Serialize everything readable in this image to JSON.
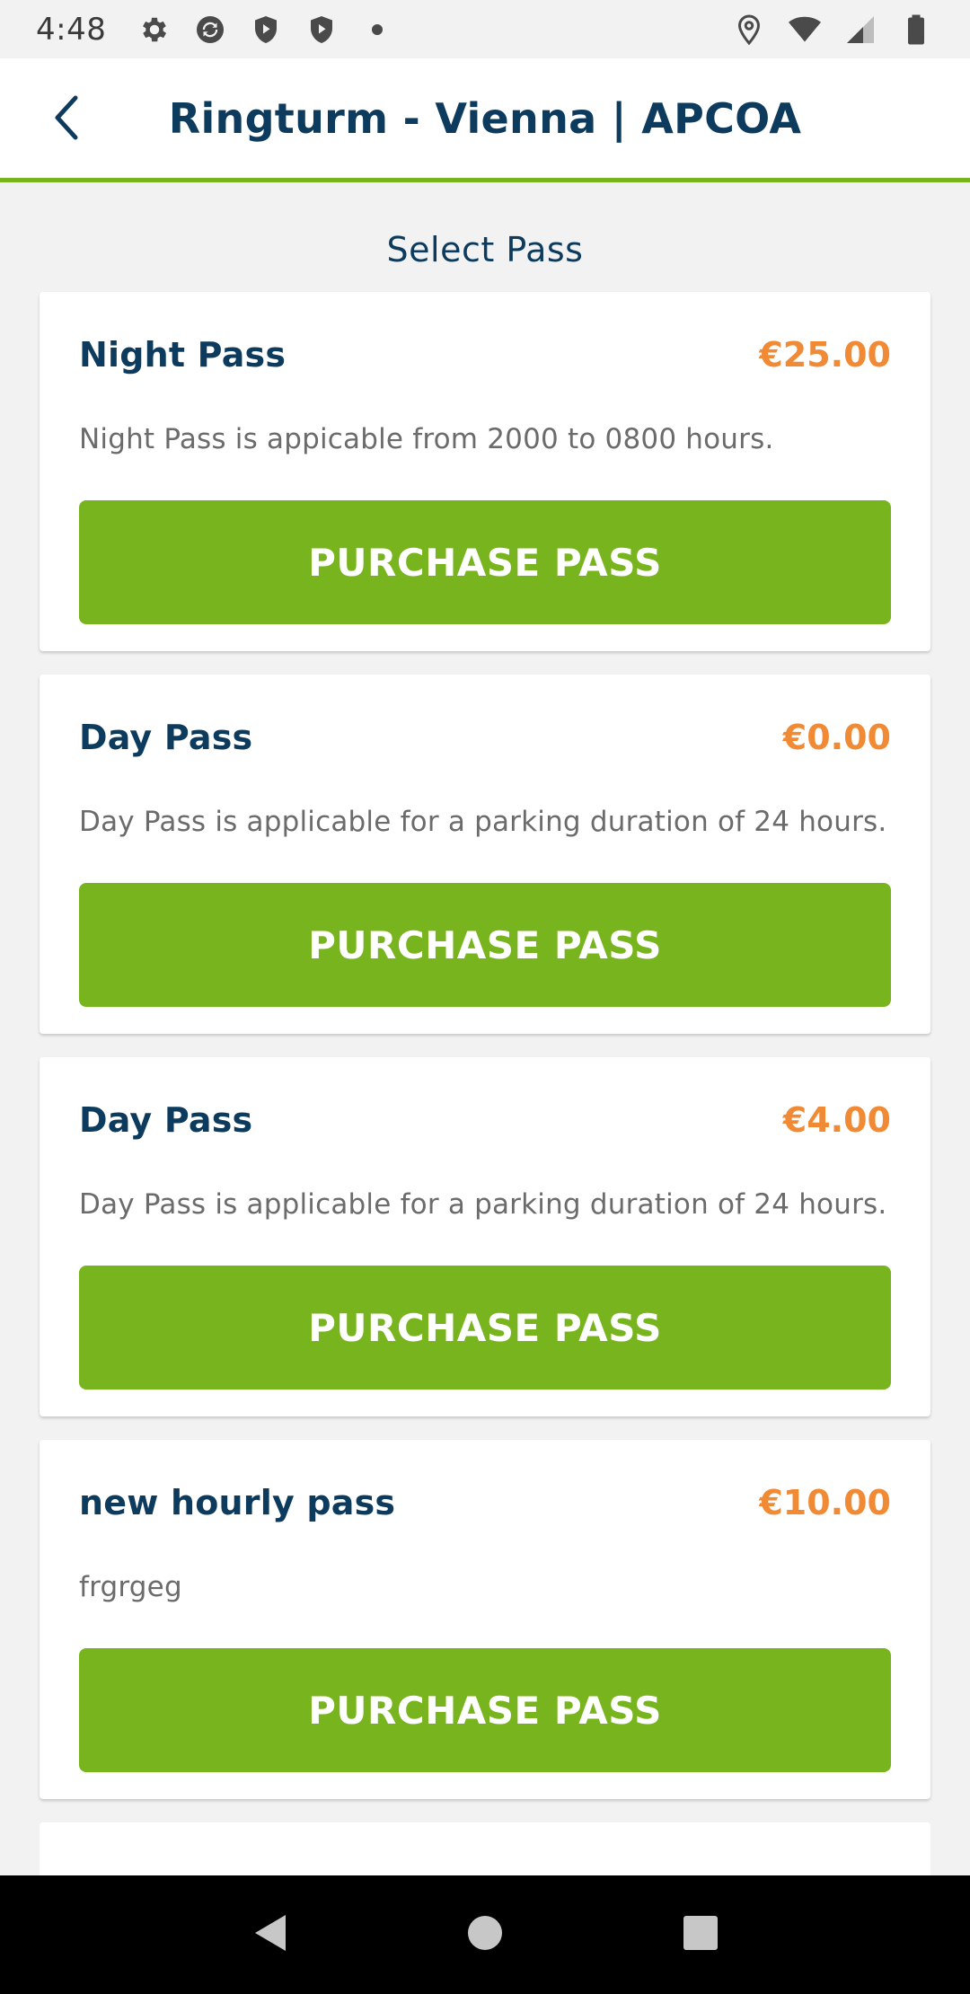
{
  "status_bar": {
    "time": "4:48",
    "left_icons": [
      "gear-icon",
      "sync-icon",
      "play-shield-icon",
      "shield-icon",
      "dot-icon"
    ],
    "right_icons": [
      "location-icon",
      "wifi-icon",
      "signal-icon",
      "battery-icon"
    ]
  },
  "app_bar": {
    "title": "Ringturm - Vienna | APCOA",
    "back_icon": "chevron-left-icon"
  },
  "main": {
    "section_title": "Select Pass",
    "passes": [
      {
        "name": "Night Pass",
        "price": "€25.00",
        "description": "Night Pass is appicable from 2000 to 0800 hours.",
        "button_label": "PURCHASE PASS"
      },
      {
        "name": "Day Pass",
        "price": "€0.00",
        "description": "Day Pass is applicable for a parking duration of 24 hours.",
        "button_label": "PURCHASE PASS"
      },
      {
        "name": "Day Pass",
        "price": "€4.00",
        "description": "Day Pass is applicable for a parking duration of 24 hours.",
        "button_label": "PURCHASE PASS"
      },
      {
        "name": "new hourly pass",
        "price": "€10.00",
        "description": "frgrgeg",
        "button_label": "PURCHASE PASS"
      }
    ]
  },
  "nav_bar": {
    "buttons": [
      "back-triangle-icon",
      "home-circle-icon",
      "recents-square-icon"
    ]
  },
  "colors": {
    "accent_green": "#78b41e",
    "title_navy": "#0d3b5e",
    "price_orange": "#f08a35"
  }
}
